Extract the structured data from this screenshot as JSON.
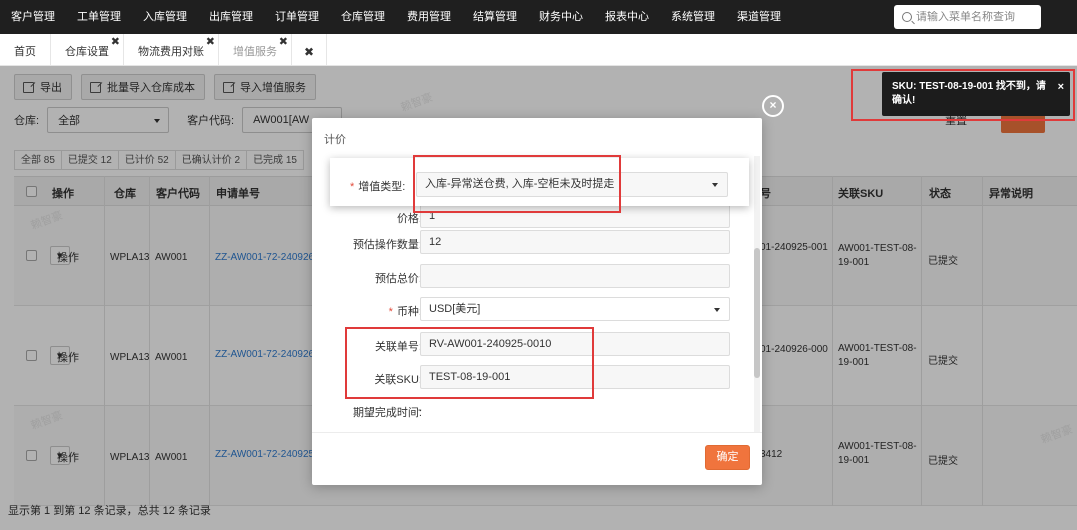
{
  "topnav": {
    "items": [
      "客户管理",
      "工单管理",
      "入库管理",
      "出库管理",
      "订单管理",
      "仓库管理",
      "费用管理",
      "结算管理",
      "财务中心",
      "报表中心",
      "系统管理",
      "渠道管理"
    ],
    "search_placeholder": "请输入菜单名称查询"
  },
  "tabs": [
    {
      "label": "首页",
      "closable": false
    },
    {
      "label": "仓库设置",
      "closable": true
    },
    {
      "label": "物流费用对账",
      "closable": true
    },
    {
      "label": "增值服务",
      "closable": true,
      "active": true
    }
  ],
  "toolbar": {
    "export": "导出",
    "batch_import_cost": "批量导入仓库成本",
    "import_vas": "导入增值服务"
  },
  "filters": {
    "warehouse_label": "仓库:",
    "warehouse_value": "全部",
    "customer_code_label": "客户代码:",
    "customer_code_value": "AW001[AW",
    "query_reset": "重置"
  },
  "status_tabs": [
    "全部 85",
    "已提交 12",
    "已计价 52",
    "已确认计价 2",
    "已完成 15"
  ],
  "table": {
    "headers": [
      "操作",
      "仓库",
      "客户代码",
      "申请单号",
      "号",
      "关联SKU",
      "状态",
      "异常说明"
    ],
    "rows": [
      {
        "op": "操作",
        "warehouse": "WPLA13",
        "customer": "AW001",
        "apply_no": "ZZ-AW001-72-240926",
        "ref": "01-240925-001",
        "sku": "AW001-TEST-08-19-001",
        "status": "已提交"
      },
      {
        "op": "操作",
        "warehouse": "WPLA13",
        "customer": "AW001",
        "apply_no": "ZZ-AW001-72-240926",
        "ref": "01-240926-000",
        "sku": "AW001-TEST-08-19-001",
        "status": "已提交"
      },
      {
        "op": "操作",
        "warehouse": "WPLA13",
        "customer": "AW001",
        "apply_no": "ZZ-AW001-72-240925",
        "ref": "3412",
        "sku": "AW001-TEST-08-19-001",
        "status": "已提交"
      }
    ]
  },
  "footer": {
    "summary": "显示第 1 到第 12 条记录，总共 12 条记录"
  },
  "modal": {
    "title": "计价",
    "vas_type_label": "增值类型:",
    "vas_type_value": "入库-异常送仓费, 入库-空柜未及时提走",
    "price_label": "价格:",
    "price_value": "1",
    "est_qty_label": "预估操作数量:",
    "est_qty_value": "12",
    "est_total_label": "预估总价:",
    "est_total_value": "",
    "currency_label": "币种:",
    "currency_value": "USD[美元]",
    "ref_no_label": "关联单号:",
    "ref_no_value": "RV-AW001-240925-0010",
    "ref_sku_label": "关联SKU:",
    "ref_sku_value": "TEST-08-19-001",
    "expected_time_label": "期望完成时间:",
    "expected_time_value": "-",
    "confirm": "确定",
    "close_symbol": "×"
  },
  "toast": {
    "message": "SKU: TEST-08-19-001 找不到，请确认!",
    "close_symbol": "×"
  },
  "watermark": "赖智豪",
  "colors": {
    "accent": "#f0743d",
    "highlight": "#e03a3a",
    "nav_bg": "#1f1f1f",
    "link": "#2f7bd0"
  }
}
